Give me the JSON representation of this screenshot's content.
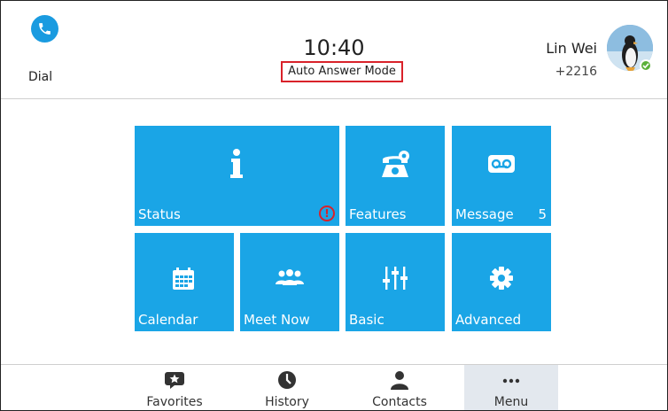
{
  "header": {
    "dial_label": "Dial",
    "time": "10:40",
    "mode_label": "Auto Answer Mode",
    "user_name": "Lin Wei",
    "user_extension": "+2216",
    "presence_status": "available"
  },
  "tiles": [
    {
      "label": "Status",
      "icon": "info-icon",
      "alert": "!"
    },
    {
      "label": "Features",
      "icon": "phone-gear-icon"
    },
    {
      "label": "Message",
      "icon": "voicemail-icon",
      "count": "5"
    },
    {
      "label": "Calendar",
      "icon": "calendar-icon"
    },
    {
      "label": "Meet Now",
      "icon": "group-icon"
    },
    {
      "label": "Basic",
      "icon": "sliders-icon"
    },
    {
      "label": "Advanced",
      "icon": "gear-icon"
    }
  ],
  "nav": [
    {
      "label": "Favorites",
      "icon": "favorites-star-icon"
    },
    {
      "label": "History",
      "icon": "clock-icon"
    },
    {
      "label": "Contacts",
      "icon": "person-icon"
    },
    {
      "label": "Menu",
      "icon": "more-icon",
      "active": true
    }
  ],
  "colors": {
    "tile": "#1aa5e6",
    "accent": "#1a9be0",
    "alert": "#d9222a",
    "presence": "#5bb03a",
    "nav_active": "#e3e8ee"
  }
}
